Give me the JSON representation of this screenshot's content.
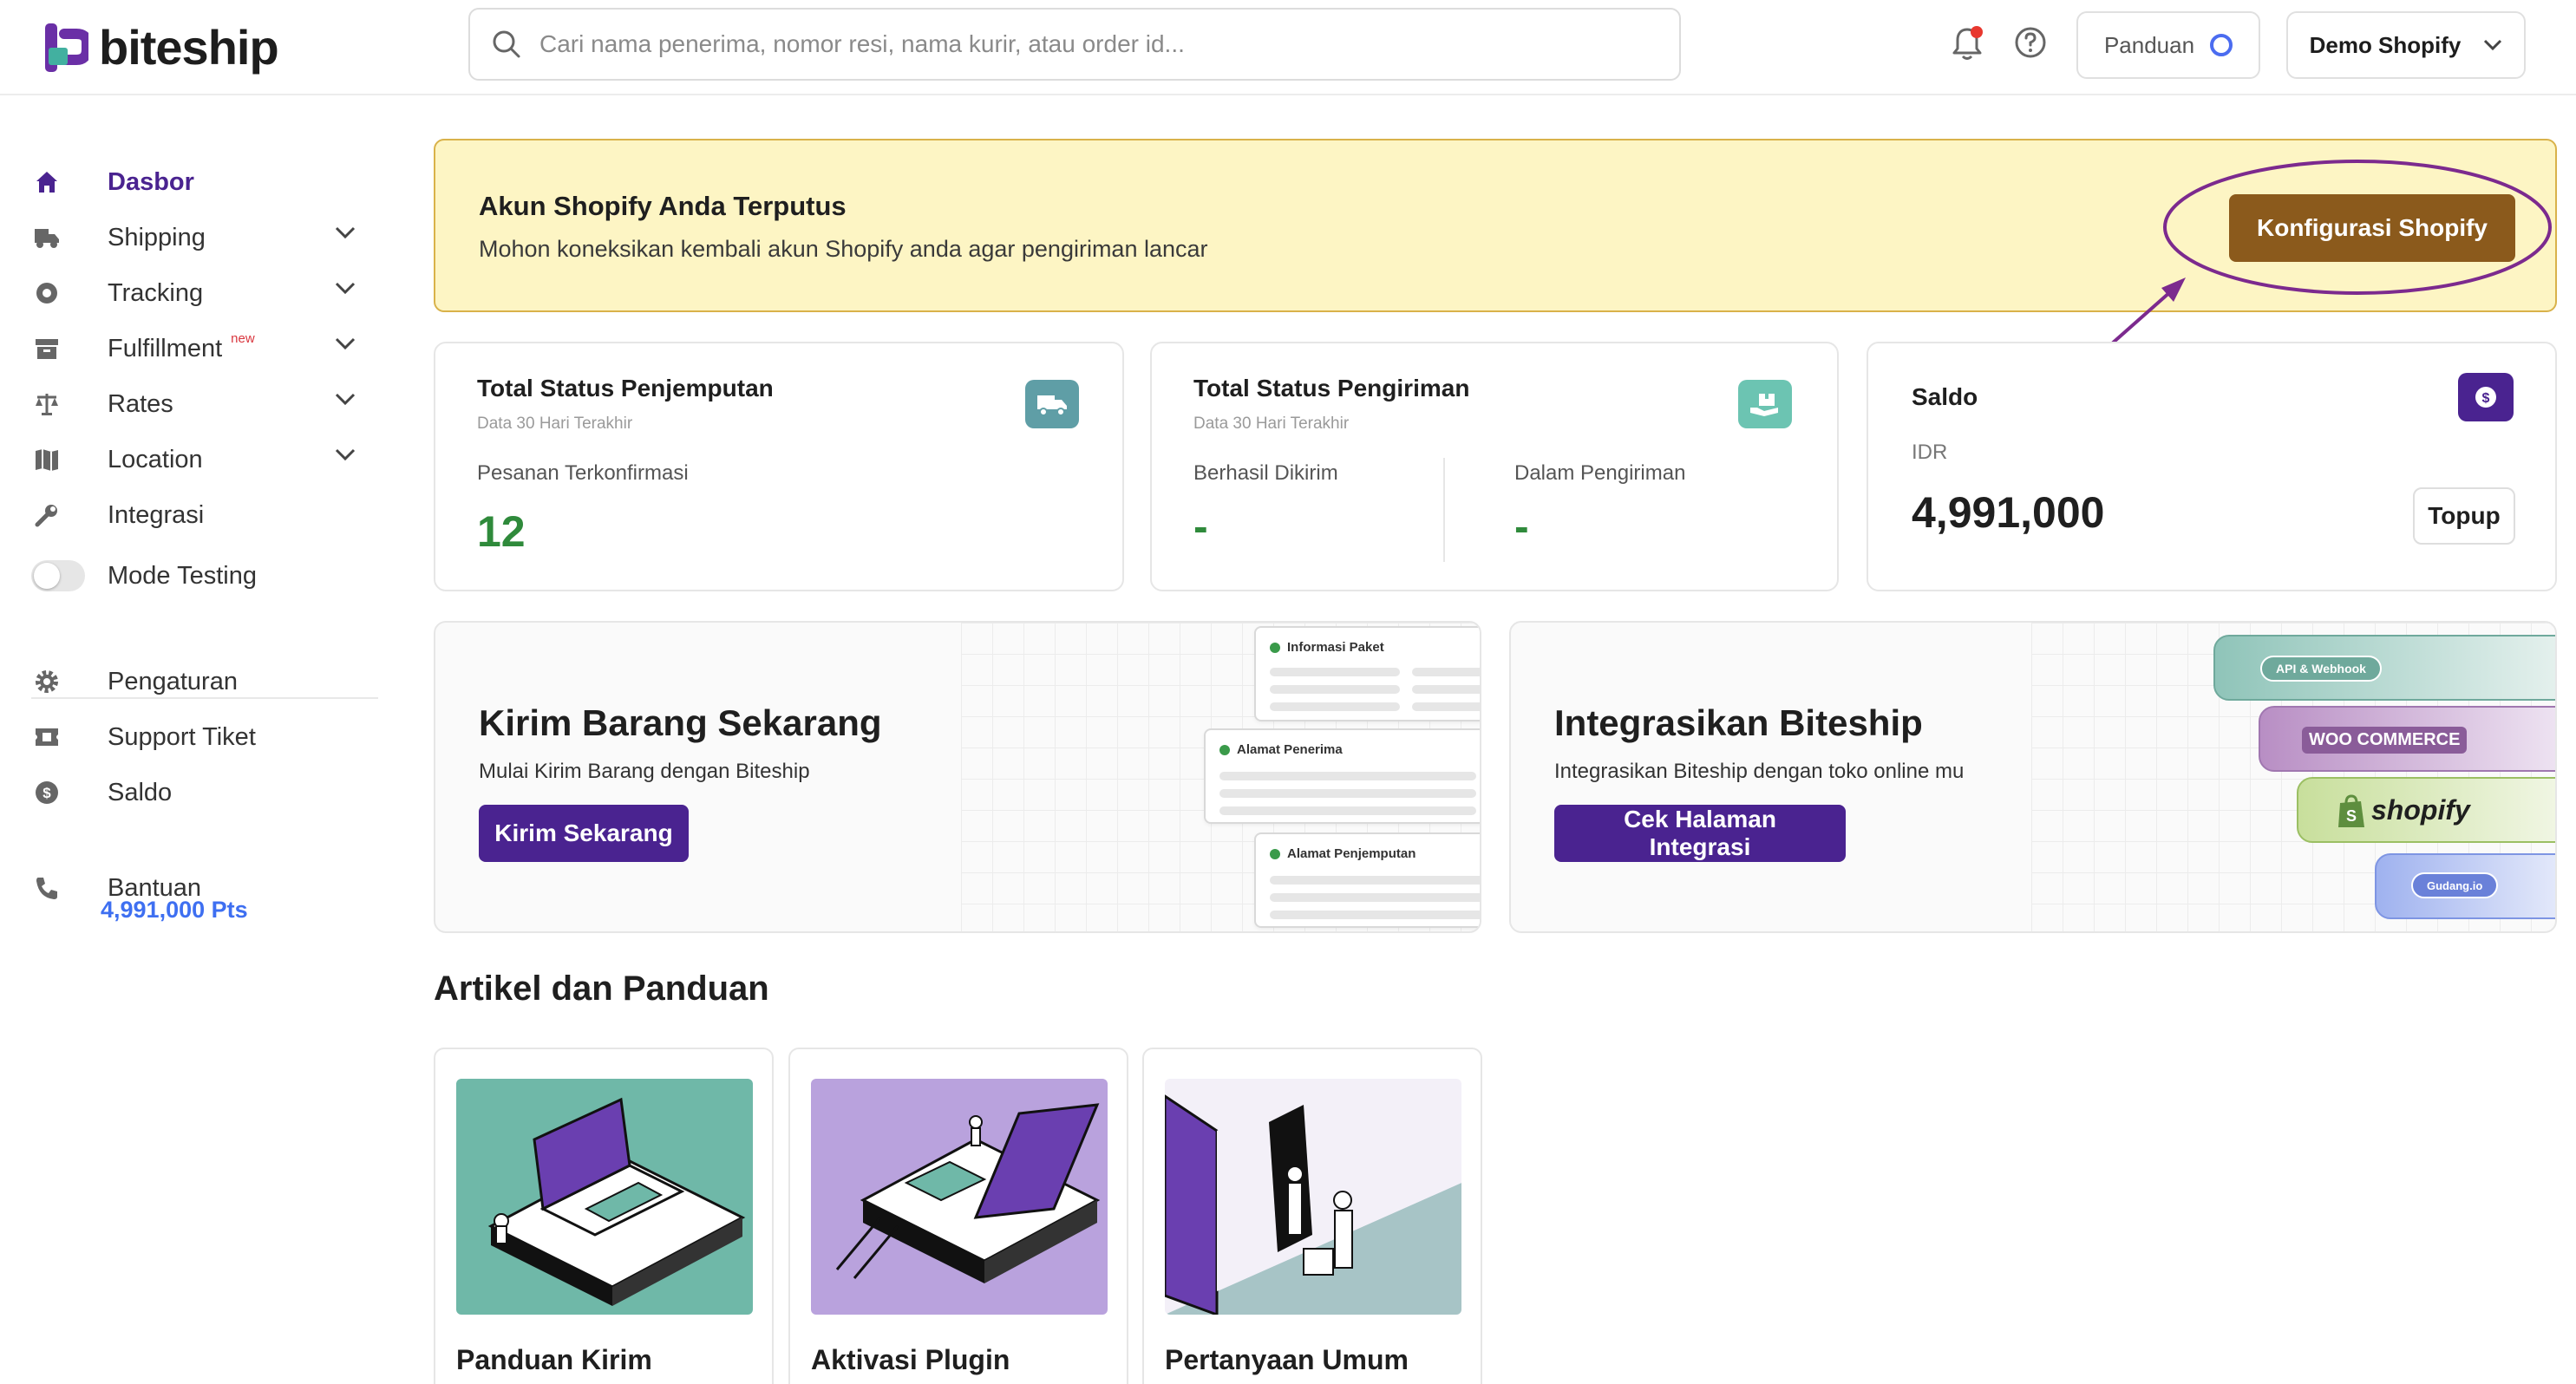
{
  "brand": {
    "name": "biteship",
    "accent": "#4a2390"
  },
  "header": {
    "search_placeholder": "Cari nama penerima, nomor resi, nama kurir, atau order id...",
    "panduan_label": "Panduan",
    "store_label": "Demo Shopify"
  },
  "sidebar": {
    "items": [
      {
        "label": "Dasbor",
        "icon": "home-icon",
        "active": true
      },
      {
        "label": "Shipping",
        "icon": "truck-icon",
        "expandable": true
      },
      {
        "label": "Tracking",
        "icon": "tracking-icon",
        "expandable": true
      },
      {
        "label": "Fulfillment",
        "icon": "box-icon",
        "expandable": true,
        "badge": "new"
      },
      {
        "label": "Rates",
        "icon": "scale-icon",
        "expandable": true
      },
      {
        "label": "Location",
        "icon": "map-icon",
        "expandable": true
      },
      {
        "label": "Integrasi",
        "icon": "wrench-icon"
      },
      {
        "label": "Mode Testing",
        "icon": "toggle-icon"
      }
    ],
    "bottom_items": [
      {
        "label": "Pengaturan",
        "icon": "gear-icon"
      },
      {
        "label": "Support Tiket",
        "icon": "ticket-icon"
      },
      {
        "label": "Saldo",
        "icon": "dollar-icon"
      },
      {
        "label": "Bantuan",
        "icon": "phone-icon"
      }
    ],
    "points": "4,991,000 Pts"
  },
  "alert": {
    "title": "Akun Shopify Anda Terputus",
    "message": "Mohon koneksikan kembali akun Shopify anda agar pengiriman lancar",
    "button": "Konfigurasi Shopify",
    "bg_color": "#fdf5c4",
    "button_color": "#8b5a1c"
  },
  "stats": {
    "pickup": {
      "title": "Total Status Penjemputan",
      "subtitle": "Data 30 Hari Terakhir",
      "label": "Pesanan Terkonfirmasi",
      "value": "12"
    },
    "delivery": {
      "title": "Total Status Pengiriman",
      "subtitle": "Data 30 Hari Terakhir",
      "delivered_label": "Berhasil Dikirim",
      "delivered_value": "-",
      "in_transit_label": "Dalam Pengiriman",
      "in_transit_value": "-"
    },
    "balance": {
      "title": "Saldo",
      "currency": "IDR",
      "value": "4,991,000",
      "topup_label": "Topup"
    }
  },
  "promos": {
    "send": {
      "title": "Kirim Barang Sekarang",
      "subtitle": "Mulai Kirim Barang dengan Biteship",
      "button": "Kirim Sekarang",
      "cards": [
        "Informasi Paket",
        "Alamat Penerima",
        "Alamat Penjemputan"
      ]
    },
    "integrate": {
      "title": "Integrasikan Biteship",
      "subtitle": "Integrasikan Biteship dengan toko online mu",
      "button": "Cek Halaman Integrasi",
      "strips": [
        "API & Webhook",
        "WOO COMMERCE",
        "shopify",
        "Gudang.io"
      ]
    }
  },
  "articles": {
    "title": "Artikel dan Panduan",
    "items": [
      {
        "title": "Panduan Kirim"
      },
      {
        "title": "Aktivasi Plugin"
      },
      {
        "title": "Pertanyaan Umum"
      }
    ]
  }
}
